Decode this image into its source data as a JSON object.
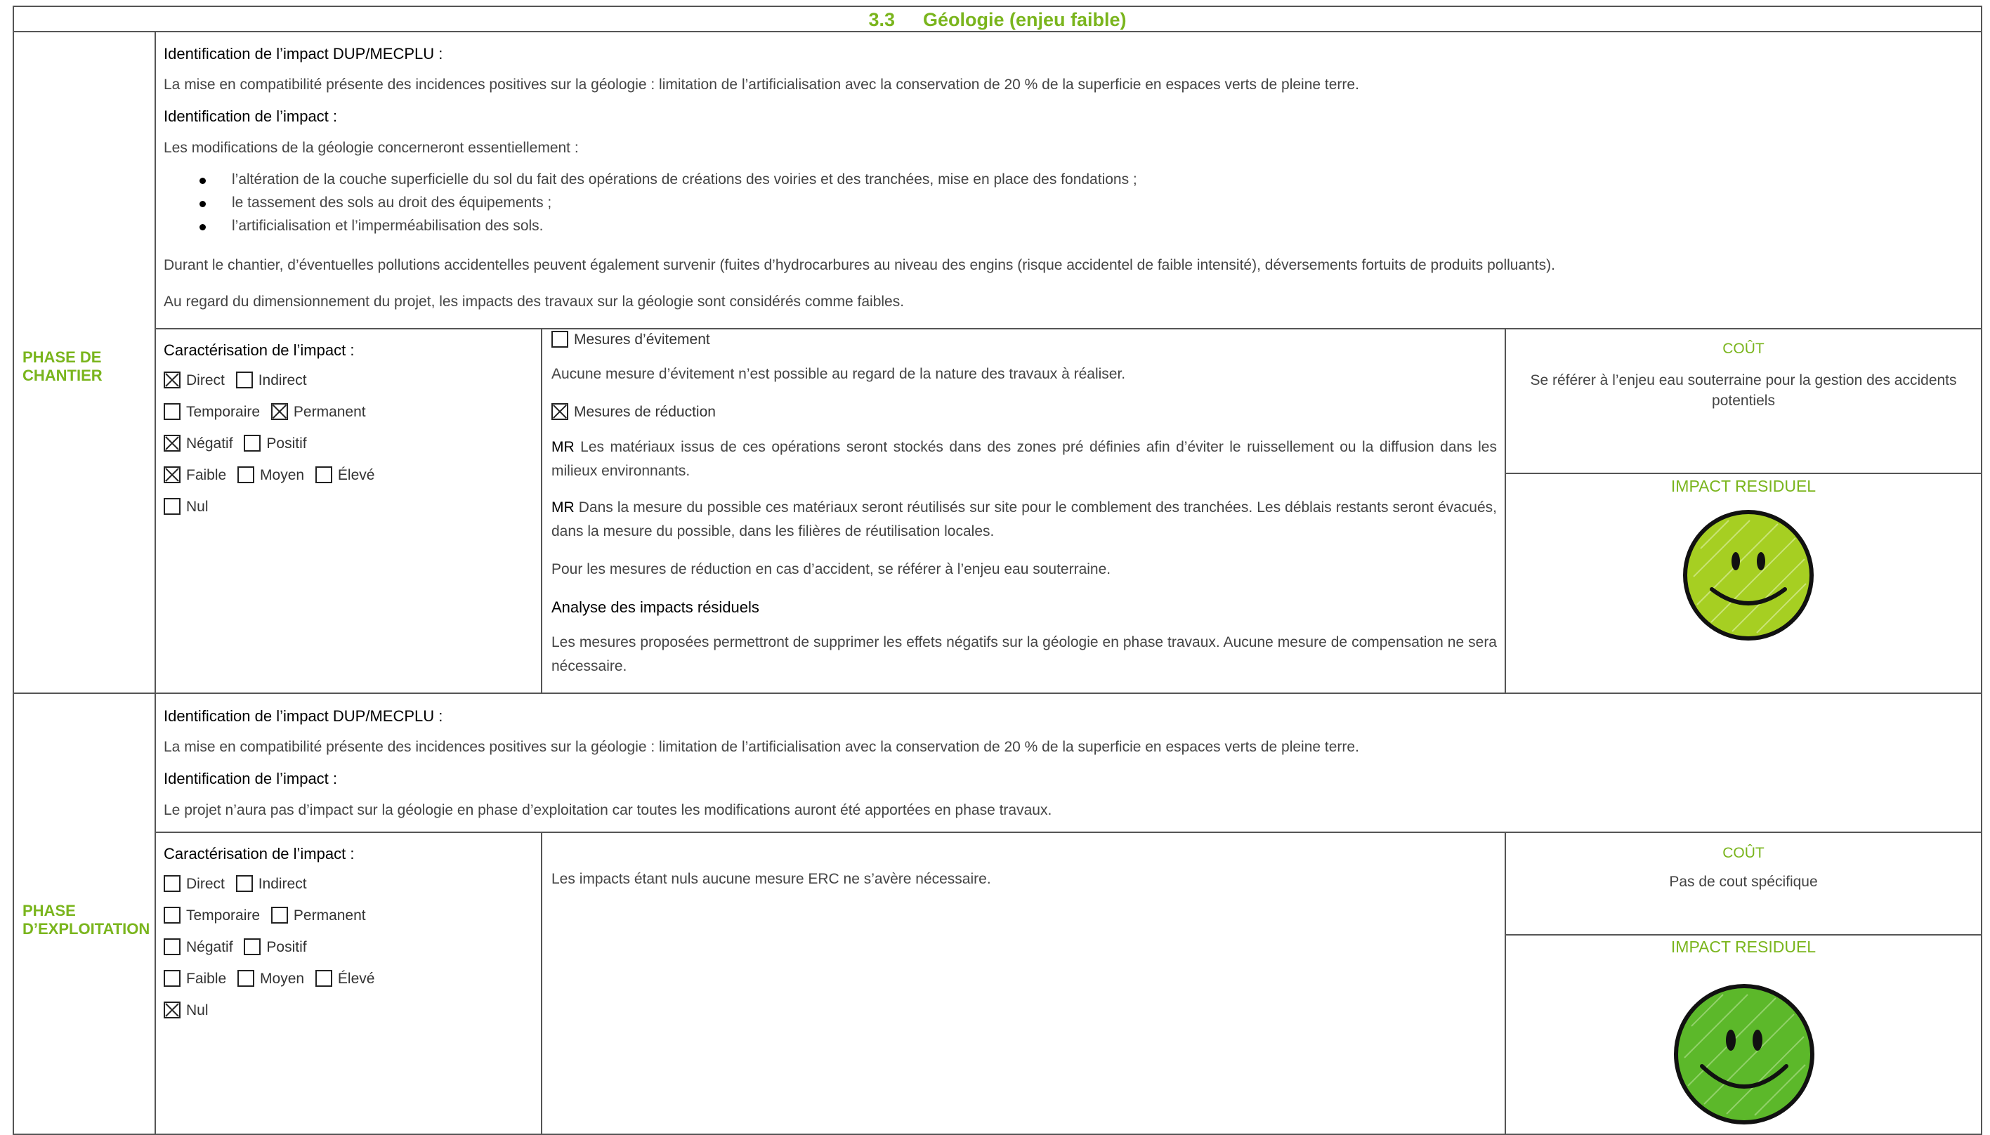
{
  "header": {
    "number": "3.3",
    "title": "Géologie (enjeu faible)"
  },
  "phases": [
    {
      "label_line1": "PHASE DE",
      "label_line2": "CHANTIER",
      "dup_title": "Identification de l’impact DUP/MECPLU :",
      "dup_text": "La mise en compatibilité présente des incidences positives sur la géologie : limitation de l’artificialisation avec la conservation de 20 % de la superficie en espaces verts de pleine terre.",
      "impact_title": "Identification de l’impact :",
      "impact_intro": "Les modifications de la géologie concerneront essentiellement :",
      "bullets": [
        "l’altération de la couche superficielle du sol du fait des opérations de créations des voiries et des tranchées, mise en place des fondations ;",
        "le tassement des sols au droit des équipements ;",
        "l’artificialisation et l’imperméabilisation des sols."
      ],
      "para1": "Durant le chantier, d’éventuelles pollutions accidentelles peuvent également survenir (fuites d’hydrocarbures au niveau des engins (risque accidentel de faible intensité), déversements fortuits de produits polluants).",
      "para2": "Au regard du dimensionnement du projet, les impacts des travaux sur la géologie sont considérés comme faibles.",
      "carac_title": "Caractérisation de l’impact :",
      "checks": {
        "direct": true,
        "indirect": false,
        "temporaire": false,
        "permanent": true,
        "negatif": true,
        "positif": false,
        "faible": true,
        "moyen": false,
        "eleve": false,
        "nul": false
      },
      "evitement_title": "Mesures d’évitement",
      "evitement_checked": false,
      "evitement_text": "Aucune mesure d’évitement n’est possible au regard de la nature des travaux à réaliser.",
      "reduction_title": "Mesures de réduction",
      "reduction_checked": true,
      "mr1_tag": "MR",
      "mr1_text": "Les matériaux issus de ces opérations seront stockés dans des zones pré définies afin d’éviter le ruissellement ou la diffusion dans les milieux environnants.",
      "mr2_tag": "MR",
      "mr2_text": "Dans la mesure du possible ces matériaux seront réutilisés sur site pour le comblement des tranchées. Les déblais restants seront évacués, dans la mesure du possible, dans les filières de réutilisation locales.",
      "accident_text": "Pour les mesures de réduction en cas d’accident, se référer à l’enjeu eau souterraine.",
      "analyse_title": "Analyse des impacts résiduels",
      "analyse_text": "Les mesures proposées permettront de supprimer les effets négatifs sur la géologie en phase travaux. Aucune mesure de compensation ne sera nécessaire.",
      "cout_title": "COÛT",
      "cout_text": "Se référer à l’enjeu eau souterraine pour la gestion des accidents potentiels",
      "residuel_title": "IMPACT RESIDUEL",
      "smiley_color": "#a6cf22"
    },
    {
      "label_line1": "PHASE",
      "label_line2": "D’EXPLOITATION",
      "dup_title": "Identification de l’impact DUP/MECPLU :",
      "dup_text": "La mise en compatibilité présente des incidences positives sur la géologie : limitation de l’artificialisation avec la conservation de 20 % de la superficie en espaces verts de pleine terre.",
      "impact_title": "Identification de l’impact :",
      "impact_text": "Le projet n’aura pas d’impact sur la géologie en phase d’exploitation car toutes les modifications auront été apportées en phase travaux.",
      "carac_title": "Caractérisation de l’impact :",
      "checks": {
        "direct": false,
        "indirect": false,
        "temporaire": false,
        "permanent": false,
        "negatif": false,
        "positif": false,
        "faible": false,
        "moyen": false,
        "eleve": false,
        "nul": true
      },
      "erc_text": "Les impacts étant nuls aucune mesure ERC ne s’avère nécessaire.",
      "cout_title": "COÛT",
      "cout_text": "Pas de cout spécifique",
      "residuel_title": "IMPACT RESIDUEL",
      "smiley_color": "#5cb82a"
    }
  ],
  "labels": {
    "direct": "Direct",
    "indirect": "Indirect",
    "temporaire": "Temporaire",
    "permanent": "Permanent",
    "negatif": "Négatif",
    "positif": "Positif",
    "faible": "Faible",
    "moyen": "Moyen",
    "eleve": "Élevé",
    "nul": "Nul"
  }
}
